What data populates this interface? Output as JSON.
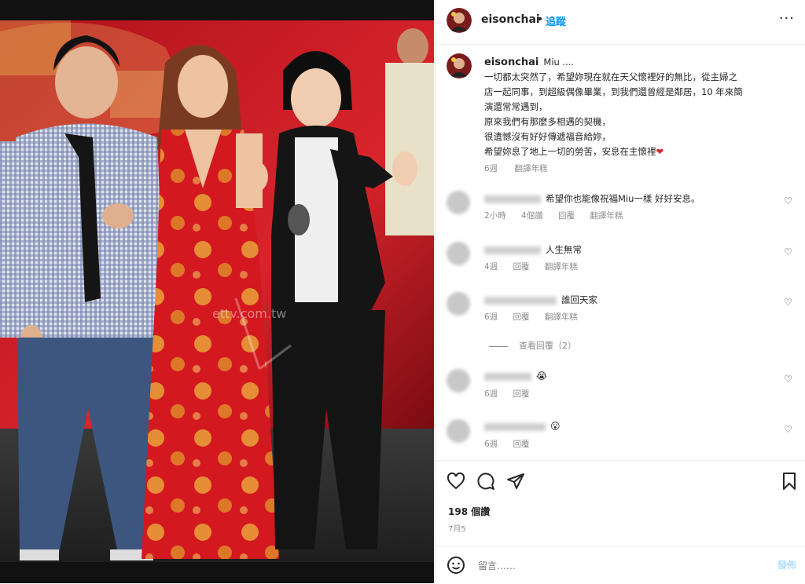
{
  "post": {
    "username": "eisonchai",
    "follow_label": "追蹤",
    "more_label": "···",
    "separator": "•"
  },
  "caption": {
    "username": "eisonchai",
    "text_lines": [
      "Miu ....",
      "一切都太突然了，希望妳現在就在天父懷裡好的無比，從主婦之",
      "店一起同事，到超級偶像畢業，到我們還曾經是鄰居，10 年來簡",
      "演還常常遇到，",
      "原來我們有那麼多相遇的契機，",
      "很遺憾沒有好好傳遞福音給妳，",
      "希望妳息了地上一切的勞苦，安息在主懷裡"
    ],
    "heart_emoji": "❤",
    "age": "6週",
    "translate_label": "翻譯年糕"
  },
  "comments": [
    {
      "text": "希望你也能像祝福Miu一樣 好好安息。",
      "age": "2小時",
      "likes": "4個讚",
      "reply_label": "回覆",
      "translate_label": "翻譯年糕"
    },
    {
      "text": "人生無常",
      "age": "4週",
      "reply_label": "回覆",
      "translate_label": "翻譯年糕"
    },
    {
      "text": "誰回天家",
      "age": "6週",
      "reply_label": "回覆",
      "translate_label": "翻譯年糕"
    },
    {
      "text": "😭",
      "age": "6週",
      "reply_label": "回覆"
    },
    {
      "text": "😮",
      "age": "6週",
      "reply_label": "回覆"
    }
  ],
  "view_replies_label": "查看回覆（2）",
  "likes_label": "198 個讚",
  "date_label": "7月5",
  "composer": {
    "placeholder": "留言……",
    "post_label": "發佈"
  },
  "photo": {
    "watermark": "ettv.com.tw"
  }
}
